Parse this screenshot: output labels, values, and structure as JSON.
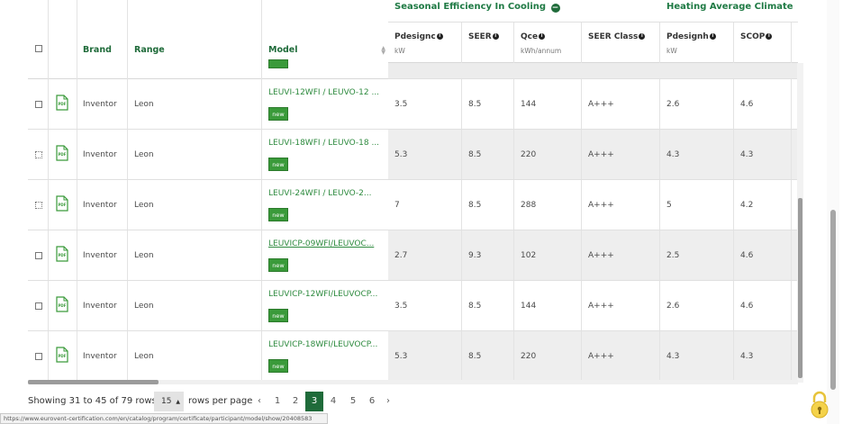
{
  "table": {
    "fixed_headers": {
      "brand": "Brand",
      "range": "Range",
      "model": "Model"
    },
    "group_headers": {
      "cooling": "Seasonal Efficiency In Cooling",
      "heating": "Heating Average Climate"
    },
    "columns": [
      {
        "title": "Pdesignc",
        "unit": "kW"
      },
      {
        "title": "SEER",
        "unit": ""
      },
      {
        "title": "Qce",
        "unit": "kWh/annum"
      },
      {
        "title": "SEER Class",
        "unit": ""
      },
      {
        "title": "Pdesignh",
        "unit": "kW"
      },
      {
        "title": "SCOP",
        "unit": ""
      }
    ],
    "rows": [
      {
        "brand": "Inventor",
        "range": "Leon",
        "model": "LEUVI-12WFI / LEUVO-12 ...",
        "badge": "new",
        "pdesignc": "3.5",
        "seer": "8.5",
        "qce": "144",
        "seer_class": "A+++",
        "pdesignh": "2.6",
        "scop": "4.6"
      },
      {
        "brand": "Inventor",
        "range": "Leon",
        "model": "LEUVI-18WFI / LEUVO-18 ...",
        "badge": "new",
        "pdesignc": "5.3",
        "seer": "8.5",
        "qce": "220",
        "seer_class": "A+++",
        "pdesignh": "4.3",
        "scop": "4.3"
      },
      {
        "brand": "Inventor",
        "range": "Leon",
        "model": "LEUVI-24WFI / LEUVO-2...",
        "badge": "new",
        "pdesignc": "7",
        "seer": "8.5",
        "qce": "288",
        "seer_class": "A+++",
        "pdesignh": "5",
        "scop": "4.2"
      },
      {
        "brand": "Inventor",
        "range": "Leon",
        "model": "LEUVICP-09WFI/LEUVOC...",
        "badge": "new",
        "pdesignc": "2.7",
        "seer": "9.3",
        "qce": "102",
        "seer_class": "A+++",
        "pdesignh": "2.5",
        "scop": "4.6"
      },
      {
        "brand": "Inventor",
        "range": "Leon",
        "model": "LEUVICP-12WFI/LEUVOCP...",
        "badge": "new",
        "pdesignc": "3.5",
        "seer": "8.5",
        "qce": "144",
        "seer_class": "A+++",
        "pdesignh": "2.6",
        "scop": "4.6"
      },
      {
        "brand": "Inventor",
        "range": "Leon",
        "model": "LEUVICP-18WFI/LEUVOCP...",
        "badge": "new",
        "pdesignc": "5.3",
        "seer": "8.5",
        "qce": "220",
        "seer_class": "A+++",
        "pdesignh": "4.3",
        "scop": "4.3"
      }
    ],
    "pdf_label": "PDF"
  },
  "pagination": {
    "showing": "Showing 31 to 45 of 79 rows",
    "rows_value": "15",
    "rows_per_page": "rows per page",
    "prev": "‹",
    "next": "›",
    "pages": [
      "1",
      "2",
      "3",
      "4",
      "5",
      "6"
    ],
    "current": "3"
  },
  "status_bar": {
    "url": "https://www.eurovent-certification.com/en/catalog/program/certificate/participant/model/show/20408583"
  },
  "colors": {
    "brand_green": "#1f6b3a",
    "link_green": "#2d8a3e",
    "badge_green": "#3a9a3a"
  }
}
